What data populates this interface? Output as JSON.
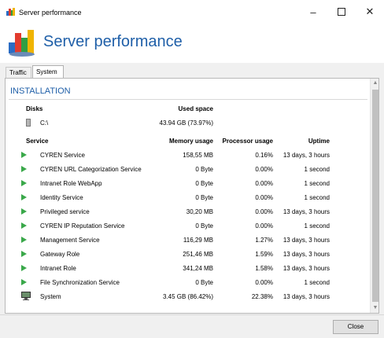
{
  "window": {
    "title": "Server performance"
  },
  "header": {
    "title": "Server performance"
  },
  "tabs": [
    {
      "label": "Traffic"
    },
    {
      "label": "System"
    }
  ],
  "section": {
    "title": "INSTALLATION"
  },
  "disks": {
    "header_label": "Disks",
    "used_header": "Used space",
    "items": [
      {
        "name": "C:\\",
        "used": "43.94 GB (73.97%)"
      }
    ]
  },
  "services": {
    "headers": {
      "service": "Service",
      "memory": "Memory usage",
      "processor": "Processor usage",
      "uptime": "Uptime"
    },
    "rows": [
      {
        "name": "CYREN Service",
        "memory": "158,55 MB",
        "processor": "0.16%",
        "uptime": "13 days, 3 hours"
      },
      {
        "name": "CYREN URL Categorization Service",
        "memory": "0 Byte",
        "processor": "0.00%",
        "uptime": "1 second"
      },
      {
        "name": "Intranet Role WebApp",
        "memory": "0 Byte",
        "processor": "0.00%",
        "uptime": "1 second"
      },
      {
        "name": "Identity Service",
        "memory": "0 Byte",
        "processor": "0.00%",
        "uptime": "1 second"
      },
      {
        "name": "Privileged service",
        "memory": "30,20 MB",
        "processor": "0.00%",
        "uptime": "13 days, 3 hours"
      },
      {
        "name": "CYREN IP Reputation Service",
        "memory": "0 Byte",
        "processor": "0.00%",
        "uptime": "1 second"
      },
      {
        "name": "Management Service",
        "memory": "116,29 MB",
        "processor": "1.27%",
        "uptime": "13 days, 3 hours"
      },
      {
        "name": "Gateway Role",
        "memory": "251,46 MB",
        "processor": "1.59%",
        "uptime": "13 days, 3 hours"
      },
      {
        "name": "Intranet Role",
        "memory": "341,24 MB",
        "processor": "1.58%",
        "uptime": "13 days, 3 hours"
      },
      {
        "name": "File Synchronization Service",
        "memory": "0 Byte",
        "processor": "0.00%",
        "uptime": "1 second"
      }
    ],
    "system": {
      "name": "System",
      "memory": "3.45 GB (86.42%)",
      "processor": "22.38%",
      "uptime": "13 days, 3 hours"
    }
  },
  "footer": {
    "close_label": "Close"
  },
  "colors": {
    "accent": "#1f5fa8",
    "running": "#3aa84a"
  },
  "icons": {
    "app": "server-performance-icon",
    "disk": "disk-drive-icon",
    "service": "service-running-icon",
    "system": "monitor-icon"
  }
}
